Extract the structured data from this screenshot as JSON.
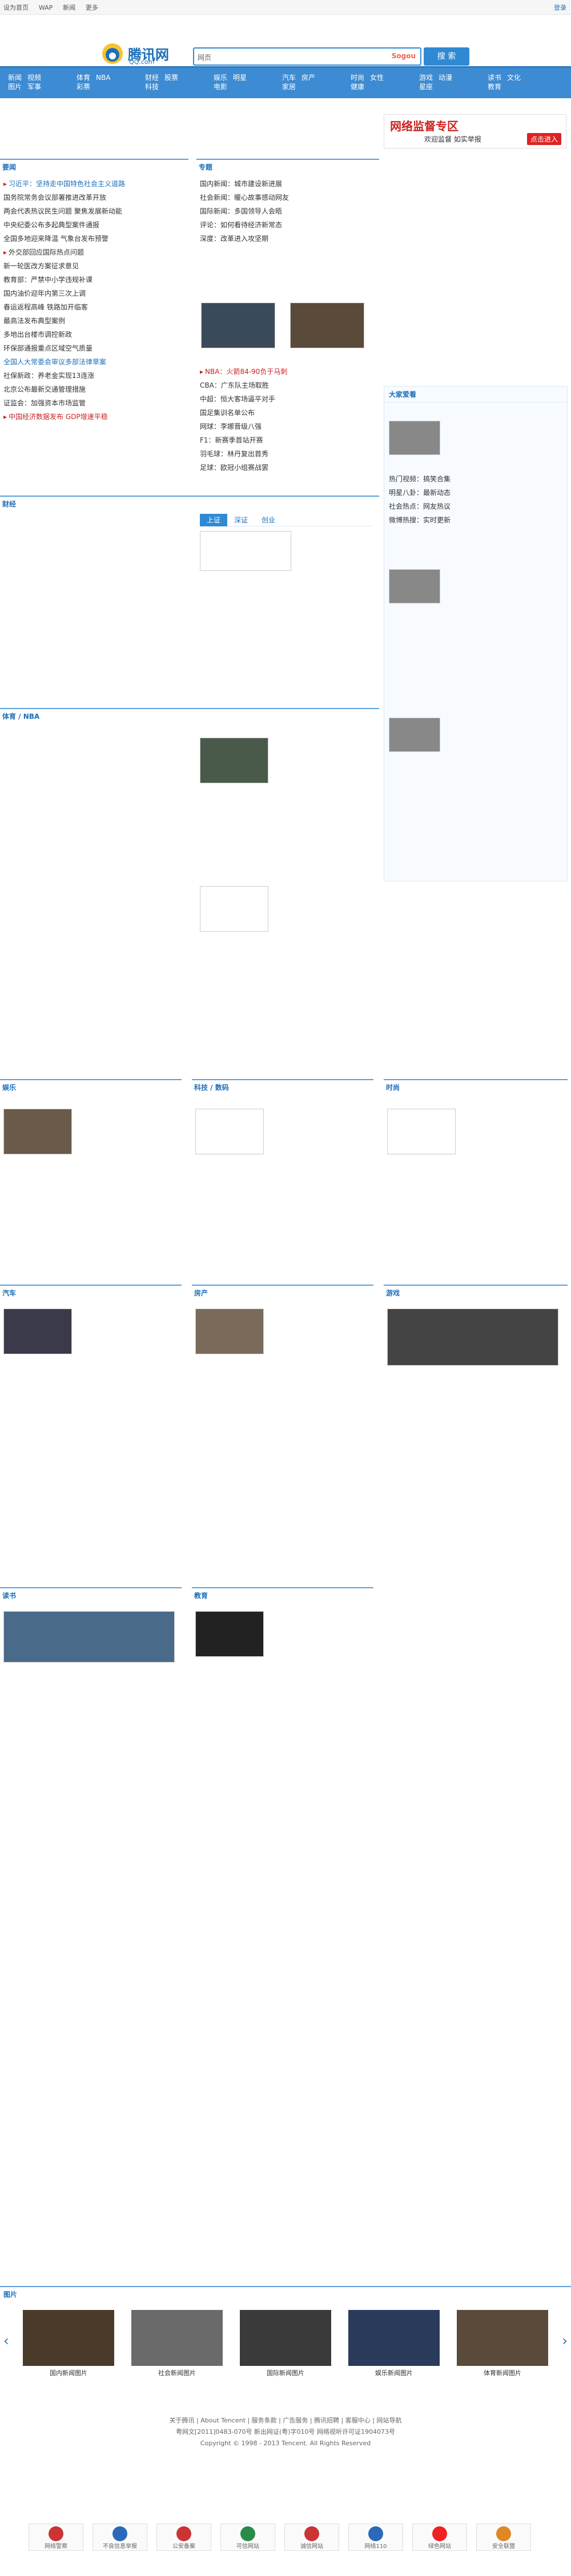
{
  "topbar": {
    "links": [
      "设为首页",
      "WAP",
      "新闻",
      "更多"
    ],
    "right": "登录"
  },
  "logo": {
    "name": "腾讯网",
    "sub": "QQ.com"
  },
  "search": {
    "select": "网页",
    "placeholder": "",
    "engine": "Sogou",
    "button": "搜 索"
  },
  "nav": {
    "groups": [
      [
        "新闻",
        "视频",
        "图片",
        "军事"
      ],
      [
        "体育",
        "NBA",
        "彩票"
      ],
      [
        "财经",
        "股票",
        "科技"
      ],
      [
        "娱乐",
        "明星",
        "电影"
      ],
      [
        "汽车",
        "房产",
        "家居"
      ],
      [
        "时尚",
        "女性",
        "健康"
      ],
      [
        "游戏",
        "动漫",
        "星座"
      ],
      [
        "读书",
        "文化",
        "教育"
      ]
    ]
  },
  "promo": {
    "title": "网络监督专区",
    "sub": "欢迎监督 如实举报",
    "badge": "点击进入"
  },
  "news": {
    "header": "要闻",
    "items": [
      "习近平：坚持走中国特色社会主义道路",
      "国务院常务会议部署推进改革开放",
      "两会代表热议民生问题 聚焦发展新动能",
      "中央纪委公布多起典型案件通报",
      "全国多地迎来降温 气象台发布预警",
      "外交部回应国际热点问题",
      "新一轮医改方案征求意见",
      "教育部：严禁中小学违规补课",
      "国内油价迎年内第三次上调",
      "春运返程高峰 铁路加开临客",
      "最高法发布典型案例",
      "多地出台楼市调控新政",
      "环保部通报重点区域空气质量",
      "全国人大常委会审议多部法律草案",
      "社保新政：养老金实现13连涨",
      "北京公布最新交通管理措施",
      "证监会：加强资本市场监管",
      "中国经济数据发布 GDP增速平稳"
    ]
  },
  "mid": {
    "header": "专题",
    "items": [
      "国内新闻：城市建设新进展",
      "社会新闻：暖心故事感动网友",
      "国际新闻：多国领导人会晤",
      "评论：如何看待经济新常态",
      "深度：改革进入攻坚期"
    ],
    "nba": "NBA：火箭84-90负于马刺",
    "more": [
      "CBA：广东队主场取胜",
      "中超：恒大客场逼平对手",
      "国足集训名单公布",
      "网球：李娜晋级八强",
      "F1：新赛季首站开赛",
      "羽毛球：林丹复出首秀",
      "足球：欧冠小组赛战罢"
    ]
  },
  "side": {
    "header": "大家爱看",
    "items": [
      "热门视频：搞笑合集",
      "明星八卦：最新动态",
      "社会热点：网友热议",
      "微博热搜：实时更新"
    ]
  },
  "sections": [
    "财经",
    "体育 / NBA",
    "娱乐",
    "科技 / 数码",
    "时尚",
    "汽车",
    "房产",
    "游戏",
    "读书",
    "教育"
  ],
  "tickers": {
    "a": "上证",
    "b": "深证",
    "c": "创业"
  },
  "gallery": {
    "header": "图片",
    "caps": [
      "国内新闻图片",
      "社会新闻图片",
      "国际新闻图片",
      "娱乐新闻图片",
      "体育新闻图片"
    ]
  },
  "footer": {
    "lines": [
      "关于腾讯 | About Tencent | 服务条款 | 广告服务 | 腾讯招聘 | 客服中心 | 网站导航",
      "粤网文[2011]0483-070号 新出网证(粤)字010号 网络视听许可证1904073号",
      "Copyright © 1998 - 2013 Tencent. All Rights Reserved"
    ]
  },
  "badges": [
    "网络警察",
    "不良信息举报",
    "公安备案",
    "可信网站",
    "诚信网站",
    "网络110",
    "绿色网站",
    "安全联盟"
  ]
}
